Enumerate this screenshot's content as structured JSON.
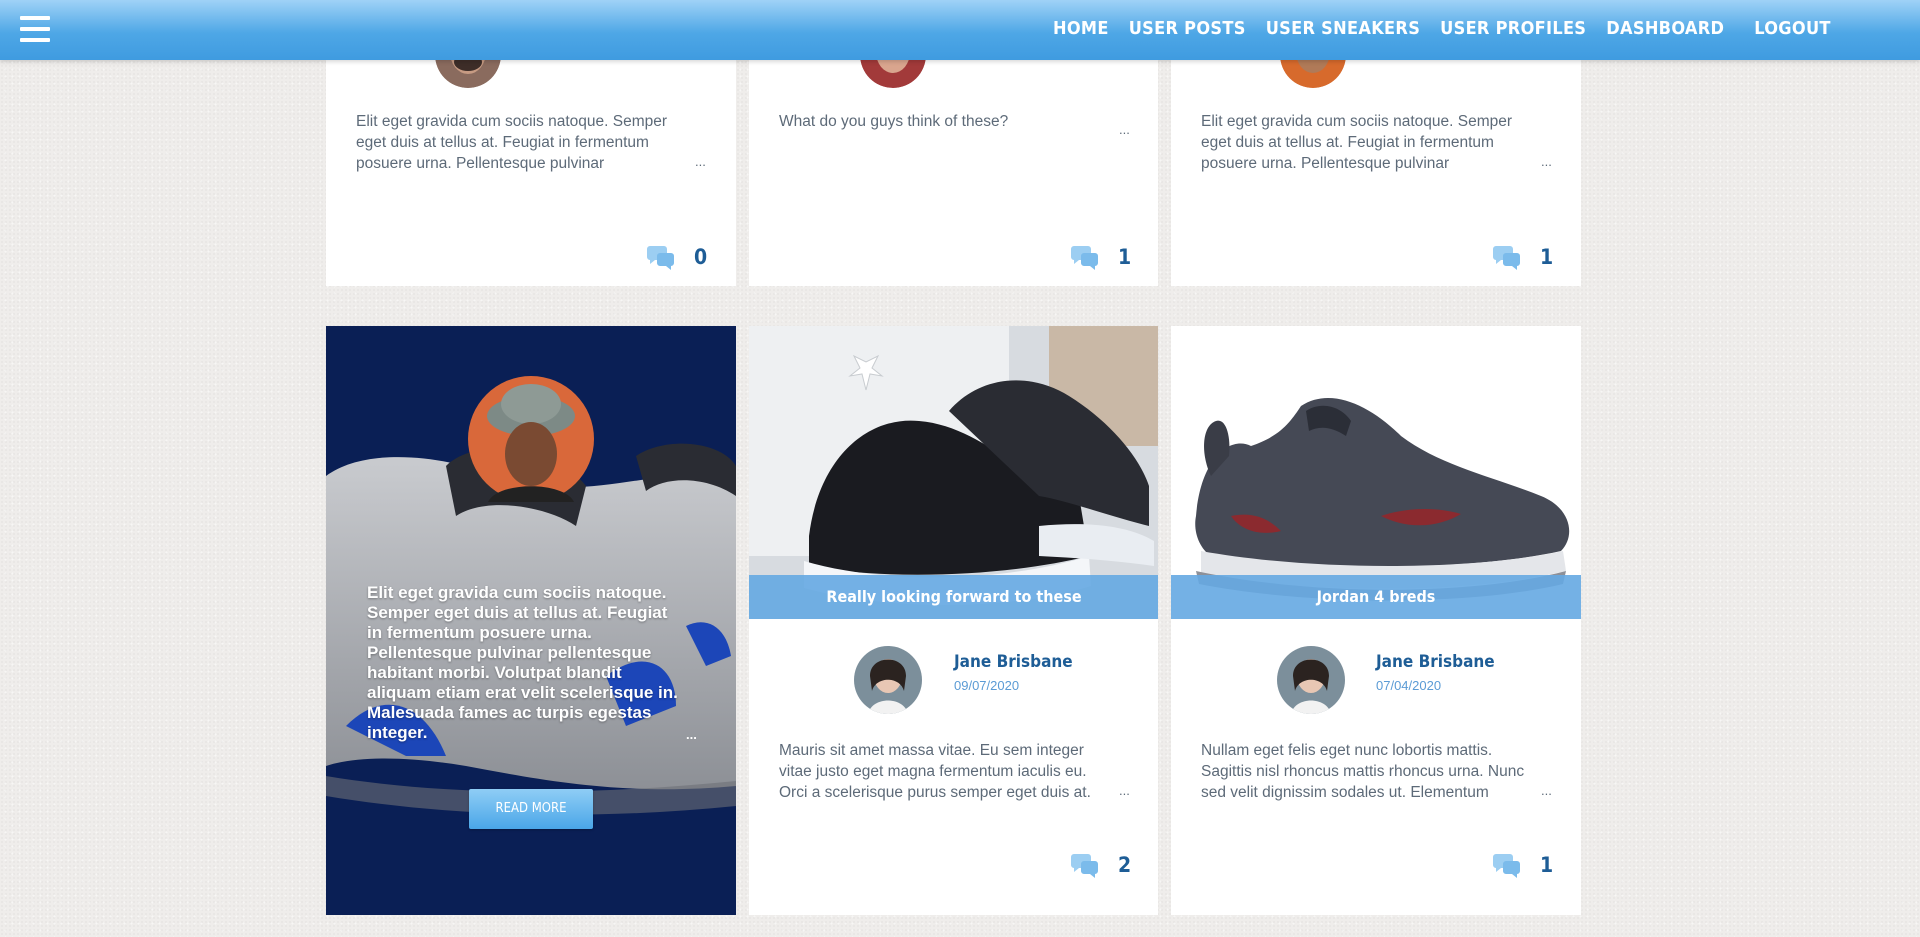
{
  "nav": {
    "links": [
      "HOME",
      "USER POSTS",
      "USER SNEAKERS",
      "USER PROFILES",
      "DASHBOARD"
    ],
    "logout": "LOGOUT"
  },
  "top_row": [
    {
      "text": "Elit eget gravida cum sociis natoque. Semper eget duis at tellus at. Feugiat in fermentum posuere urna. Pellentesque pulvinar",
      "ellipsis": "...",
      "comments": "0"
    },
    {
      "text": "What do you guys think of these?",
      "ellipsis": "...",
      "comments": "1"
    },
    {
      "text": "Elit eget gravida cum sociis natoque. Semper eget duis at tellus at. Feugiat in fermentum posuere urna. Pellentesque pulvinar",
      "ellipsis": "...",
      "comments": "1"
    }
  ],
  "featured": {
    "text": "Elit eget gravida cum sociis natoque. Semper eget duis at tellus at. Feugiat in fermentum posuere urna. Pellentesque pulvinar pellentesque habitant morbi. Volutpat blandit aliquam etiam erat velit scelerisque in. Malesuada fames ac turpis egestas integer.",
    "ellipsis": "...",
    "button": "READ MORE"
  },
  "posts": [
    {
      "banner": "Really looking forward to these",
      "author": "Jane Brisbane",
      "date": "09/07/2020",
      "text": "Mauris sit amet massa vitae. Eu sem integer vitae justo eget magna fermentum iaculis eu. Orci a scelerisque purus semper eget duis at.",
      "ellipsis": "...",
      "comments": "2"
    },
    {
      "banner": "Jordan 4 breds",
      "author": "Jane Brisbane",
      "date": "07/04/2020",
      "text": "Nullam eget felis eget nunc lobortis mattis. Sagittis nisl rhoncus mattis rhoncus urna. Nunc sed velit dignissim sodales ut. Elementum",
      "ellipsis": "...",
      "comments": "1"
    }
  ],
  "colors": {
    "nav_top": "#9fd2f7",
    "nav_bottom": "#3f9be0",
    "banner": "#65a8e2",
    "author_name": "#1e5d96",
    "featured_bg": "#0a1f55",
    "comment_icon": "#9ccef2"
  },
  "icons": {
    "menu": "hamburger-icon",
    "comment": "speech-bubbles-icon"
  }
}
